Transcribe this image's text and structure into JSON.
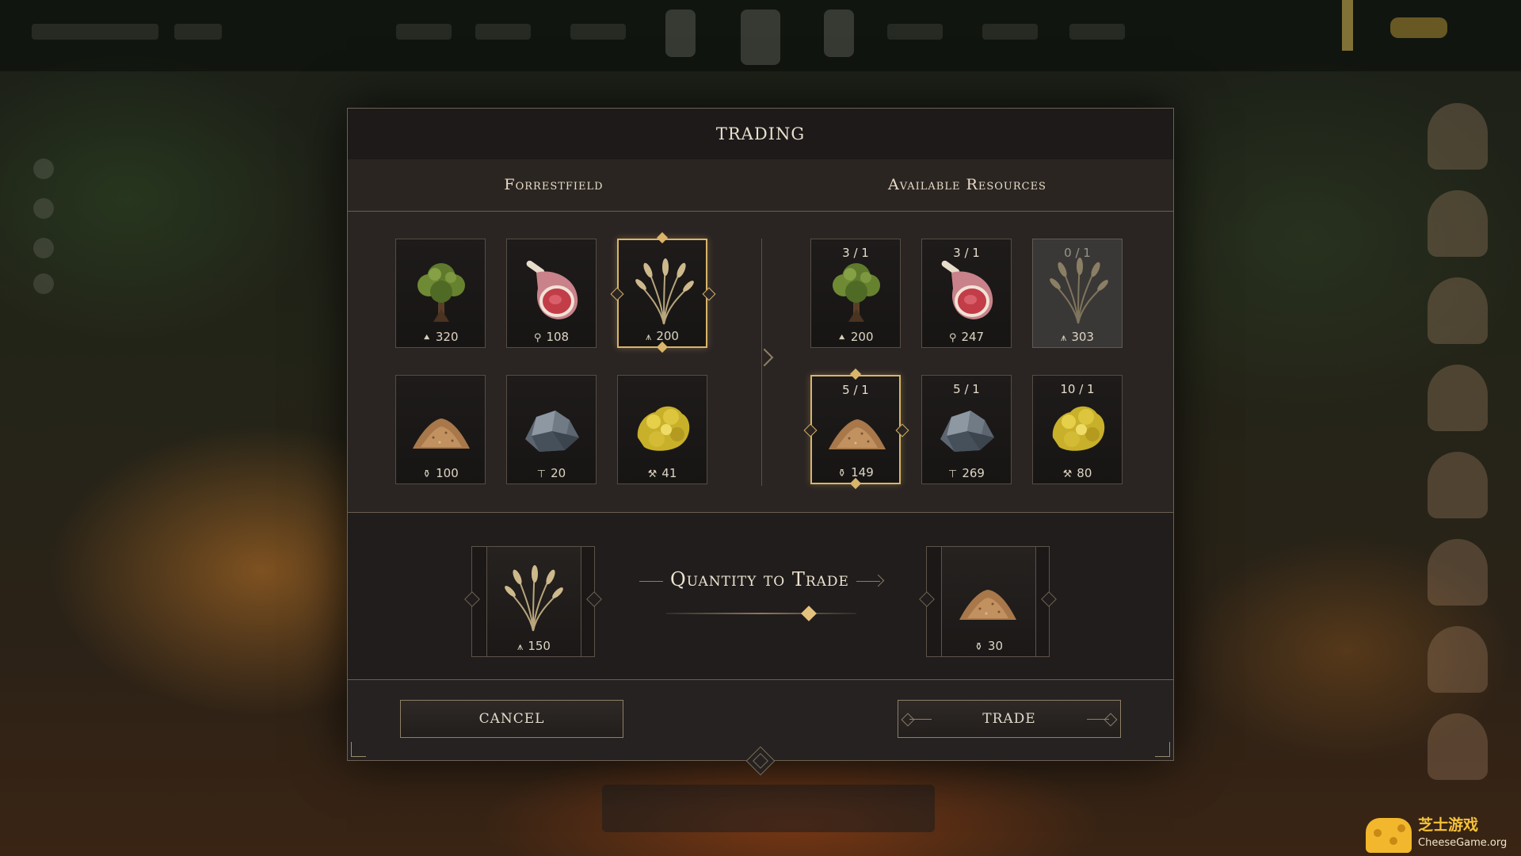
{
  "dialog": {
    "title": "TRADING"
  },
  "columns": {
    "left_title": "Forrestfield",
    "right_title": "Available Resources"
  },
  "left_resources": [
    {
      "name": "wood",
      "glyph": "tree-icon",
      "count": "320"
    },
    {
      "name": "meat",
      "glyph": "meat-icon",
      "count": "108"
    },
    {
      "name": "wheat",
      "glyph": "wheat-icon",
      "count": "200",
      "selected": true
    },
    {
      "name": "sand",
      "glyph": "pot-icon",
      "count": "100"
    },
    {
      "name": "stone",
      "glyph": "anvil-icon",
      "count": "20"
    },
    {
      "name": "gold",
      "glyph": "ore-icon",
      "count": "41"
    }
  ],
  "right_resources": [
    {
      "name": "wood",
      "ratio": "3 / 1",
      "glyph": "tree-icon",
      "count": "200"
    },
    {
      "name": "meat",
      "ratio": "3 / 1",
      "glyph": "meat-icon",
      "count": "247"
    },
    {
      "name": "wheat",
      "ratio": "0 / 1",
      "glyph": "wheat-icon",
      "count": "303",
      "disabled": true
    },
    {
      "name": "sand",
      "ratio": "5 / 1",
      "glyph": "pot-icon",
      "count": "149",
      "selected": true
    },
    {
      "name": "stone",
      "ratio": "5 / 1",
      "glyph": "anvil-icon",
      "count": "269"
    },
    {
      "name": "gold",
      "ratio": "10 / 1",
      "glyph": "ore-icon",
      "count": "80"
    }
  ],
  "trade": {
    "give": {
      "name": "wheat",
      "glyph": "wheat-icon",
      "count": "150"
    },
    "receive": {
      "name": "sand",
      "glyph": "pot-icon",
      "count": "30"
    },
    "quantity_label": "Quantity to Trade",
    "slider_fraction": 0.75
  },
  "buttons": {
    "cancel": "CANCEL",
    "trade": "TRADE"
  },
  "watermark": {
    "cn": "芝士游戏",
    "site": "CheeseGame.org"
  },
  "colors": {
    "accent_gold": "#d9b46a",
    "panel_bg": "#262221",
    "border": "#6d6152"
  }
}
